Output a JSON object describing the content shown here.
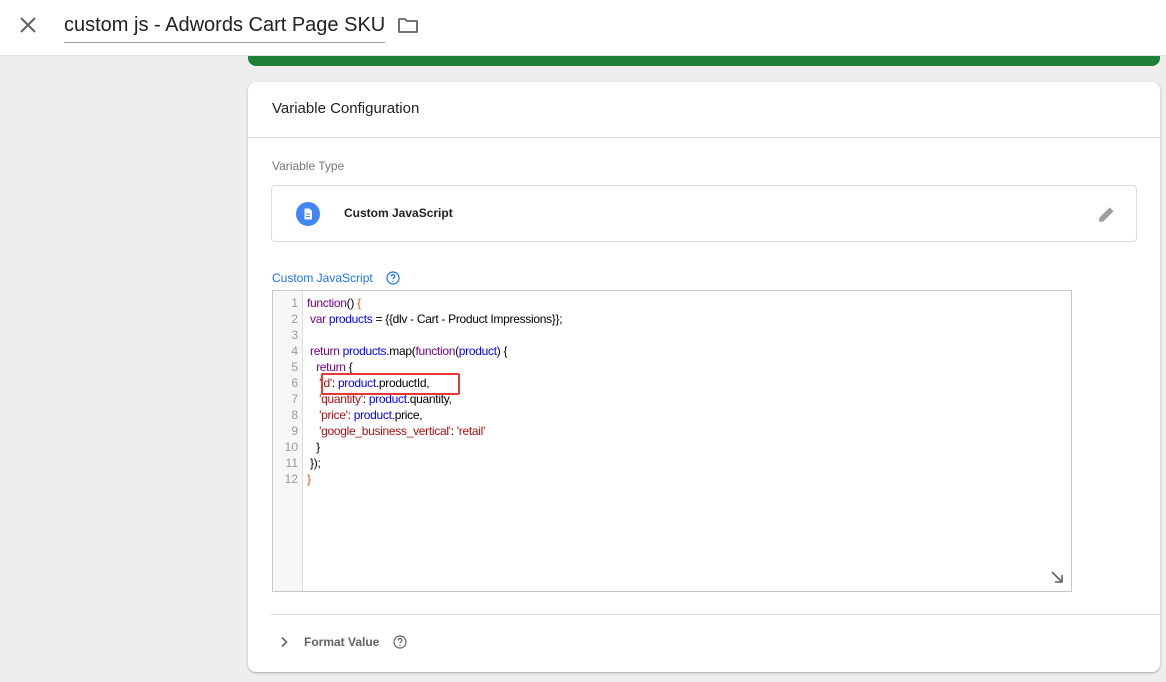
{
  "header": {
    "title": "custom js - Adwords Cart Page SKU",
    "close_icon": "close-icon",
    "folder_icon": "folder-icon"
  },
  "card": {
    "title": "Variable Configuration",
    "variable_type_label": "Variable Type",
    "variable_type_name": "Custom JavaScript",
    "variable_type_icon": "document-icon",
    "edit_icon": "pencil-icon",
    "custom_js_label": "Custom JavaScript",
    "help_icon": "help-circle-icon"
  },
  "editor": {
    "line_numbers": [
      "1",
      "2",
      "3",
      "4",
      "5",
      "6",
      "7",
      "8",
      "9",
      "10",
      "11",
      "12"
    ],
    "lines": [
      [
        {
          "t": "function",
          "c": "kw"
        },
        {
          "t": "() ",
          "c": ""
        },
        {
          "t": "{",
          "c": "bracket"
        }
      ],
      [
        {
          "t": " var ",
          "c": "kw"
        },
        {
          "t": "products",
          "c": "var"
        },
        {
          "t": " = {{dlv - Cart - Product Impressions}};",
          "c": ""
        }
      ],
      [],
      [
        {
          "t": " return ",
          "c": "kw"
        },
        {
          "t": "products",
          "c": "var"
        },
        {
          "t": ".map(",
          "c": ""
        },
        {
          "t": "function",
          "c": "kw"
        },
        {
          "t": "(",
          "c": ""
        },
        {
          "t": "product",
          "c": "var"
        },
        {
          "t": ") {",
          "c": ""
        }
      ],
      [
        {
          "t": "   return ",
          "c": "kw"
        },
        {
          "t": "{",
          "c": ""
        }
      ],
      [
        {
          "t": "    'id'",
          "c": "str"
        },
        {
          "t": ": ",
          "c": ""
        },
        {
          "t": "product",
          "c": "var"
        },
        {
          "t": ".productId,",
          "c": ""
        }
      ],
      [
        {
          "t": "    'quantity'",
          "c": "str"
        },
        {
          "t": ": ",
          "c": ""
        },
        {
          "t": "product",
          "c": "var"
        },
        {
          "t": ".quantity,",
          "c": ""
        }
      ],
      [
        {
          "t": "    'price'",
          "c": "str"
        },
        {
          "t": ": ",
          "c": ""
        },
        {
          "t": "product",
          "c": "var"
        },
        {
          "t": ".price,",
          "c": ""
        }
      ],
      [
        {
          "t": "    'google_business_vertical'",
          "c": "str"
        },
        {
          "t": ": ",
          "c": ""
        },
        {
          "t": "'retail'",
          "c": "str"
        }
      ],
      [
        {
          "t": "   }",
          "c": ""
        }
      ],
      [
        {
          "t": " });",
          "c": ""
        }
      ],
      [
        {
          "t": "}",
          "c": "bracket"
        }
      ]
    ],
    "resize_icon": "resize-handle-icon"
  },
  "format_value": {
    "label": "Format Value",
    "chevron_icon": "chevron-right-icon",
    "help_icon": "help-circle-icon"
  },
  "colors": {
    "green_bar": "#1e7e34",
    "link_blue": "#1a73e8",
    "icon_blue": "#4285f4",
    "highlight_red": "#e53935"
  }
}
